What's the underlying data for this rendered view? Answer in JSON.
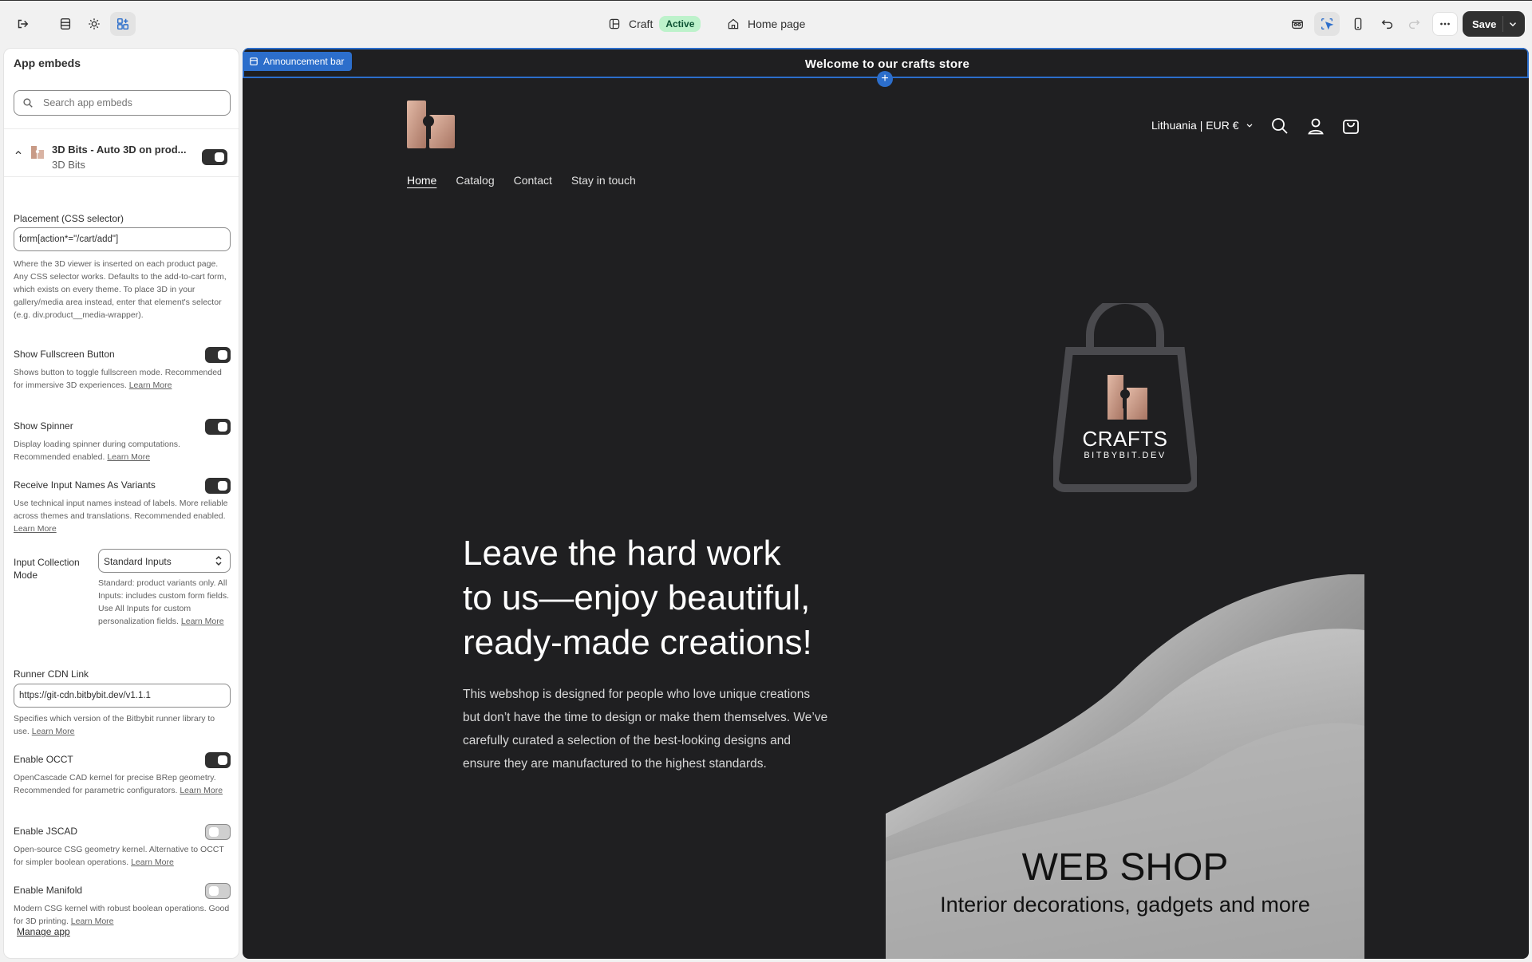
{
  "topbar": {
    "theme_name": "Craft",
    "theme_status": "Active",
    "page_name": "Home page",
    "save_label": "Save"
  },
  "panel": {
    "title": "App embeds",
    "search_placeholder": "Search app embeds",
    "app": {
      "name": "3D Bits - Auto 3D on prod...",
      "vendor": "3D Bits"
    },
    "placement": {
      "label": "Placement (CSS selector)",
      "value": "form[action*=\"/cart/add\"]",
      "help": "Where the 3D viewer is inserted on each product page. Any CSS selector works. Defaults to the add-to-cart form, which exists on every theme. To place 3D in your gallery/media area instead, enter that element's selector (e.g. div.product__media-wrapper)."
    },
    "fullscreen": {
      "label": "Show Fullscreen Button",
      "help": "Shows button to toggle fullscreen mode. Recommended for immersive 3D experiences.",
      "learn": "Learn More"
    },
    "spinner": {
      "label": "Show Spinner",
      "help": "Display loading spinner during computations. Recommended enabled.",
      "learn": "Learn More"
    },
    "input_names": {
      "label": "Receive Input Names As Variants",
      "help": "Use technical input names instead of labels. More reliable across themes and translations. Recommended enabled.",
      "learn": "Learn More"
    },
    "collection": {
      "label": "Input Collection Mode",
      "value": "Standard Inputs",
      "help": "Standard: product variants only. All Inputs: includes custom form fields. Use All Inputs for custom personalization fields.",
      "learn": "Learn More"
    },
    "runner": {
      "label": "Runner CDN Link",
      "value": "https://git-cdn.bitbybit.dev/v1.1.1",
      "help": "Specifies which version of the Bitbybit runner library to use.",
      "learn": "Learn More"
    },
    "occt": {
      "label": "Enable OCCT",
      "help": "OpenCascade CAD kernel for precise BRep geometry. Recommended for parametric configurators.",
      "learn": "Learn More"
    },
    "jscad": {
      "label": "Enable JSCAD",
      "help": "Open-source CSG geometry kernel. Alternative to OCCT for simpler boolean operations.",
      "learn": "Learn More"
    },
    "manifold": {
      "label": "Enable Manifold",
      "help": "Modern CSG kernel with robust boolean operations. Good for 3D printing.",
      "learn": "Learn More"
    },
    "manage": "Manage app"
  },
  "preview": {
    "section_tag": "Announcement bar",
    "announcement": "Welcome to our crafts store",
    "region": "Lithuania | EUR €",
    "nav": [
      "Home",
      "Catalog",
      "Contact",
      "Stay in touch"
    ],
    "bag_title": "CRAFTS",
    "bag_subtitle": "BITBYBIT.DEV",
    "headline_lines": [
      "Leave the hard work",
      "to us—enjoy beautiful,",
      "ready-made creations!"
    ],
    "body": "This webshop is designed for people who love unique creations but don’t have the time to design or make them themselves. We’ve carefully curated a selection of the best-looking designs and ensure they are manufactured to the highest standards.",
    "promo_title": "WEB SHOP",
    "promo_subtitle": "Interior decorations, gadgets and more"
  },
  "colors": {
    "accent": "#2c6ecb",
    "preview_bg": "#1f1f21",
    "active_badge": "#bdf2cb",
    "logo_copper": "#c89a86"
  }
}
